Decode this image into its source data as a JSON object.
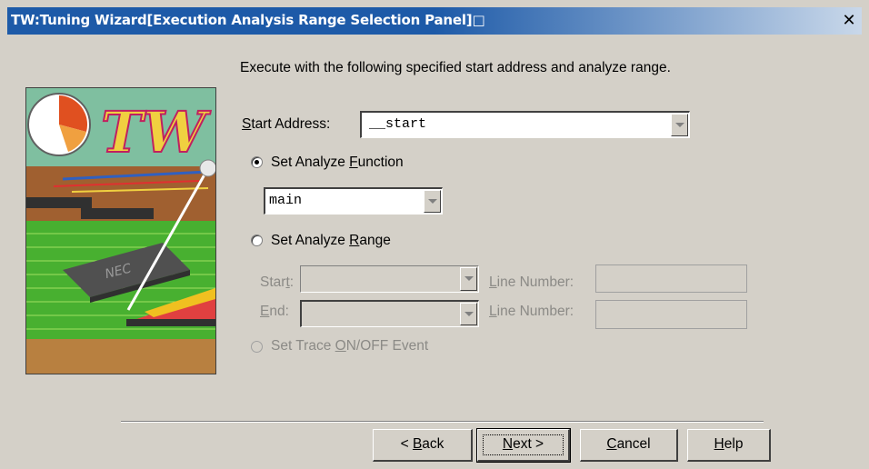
{
  "window": {
    "title": "TW:Tuning Wizard[Execution Analysis Range Selection Panel]□",
    "close": "✕"
  },
  "intro": "Execute with the following specified start address and analyze range.",
  "start_address": {
    "label_pre": "",
    "label_u": "S",
    "label_post": "tart Address:",
    "value": "__start"
  },
  "analyze_function": {
    "label_pre": "Set Analyze ",
    "label_u": "F",
    "label_post": "unction",
    "selected": true,
    "value": "main"
  },
  "analyze_range": {
    "label_pre": "Set Analyze ",
    "label_u": "R",
    "label_post": "ange",
    "selected": false,
    "start_label_pre": "Star",
    "start_label_u": "t",
    "start_label_post": ":",
    "end_label_u": "E",
    "end_label_post": "nd:",
    "line_number_u": "L",
    "line_number_post": "ine Number:"
  },
  "trace_event": {
    "label_pre": "Set Trace ",
    "label_u": "O",
    "label_post": "N/OFF Event"
  },
  "art": {
    "brand_text": "TW",
    "chip_text": "NEC"
  },
  "buttons": {
    "back": {
      "pre": "< ",
      "u": "B",
      "post": "ack"
    },
    "next": {
      "pre": "",
      "u": "N",
      "post": "ext >"
    },
    "cancel": {
      "pre": "",
      "u": "C",
      "post": "ancel"
    },
    "help": {
      "pre": "",
      "u": "H",
      "post": "elp"
    }
  }
}
